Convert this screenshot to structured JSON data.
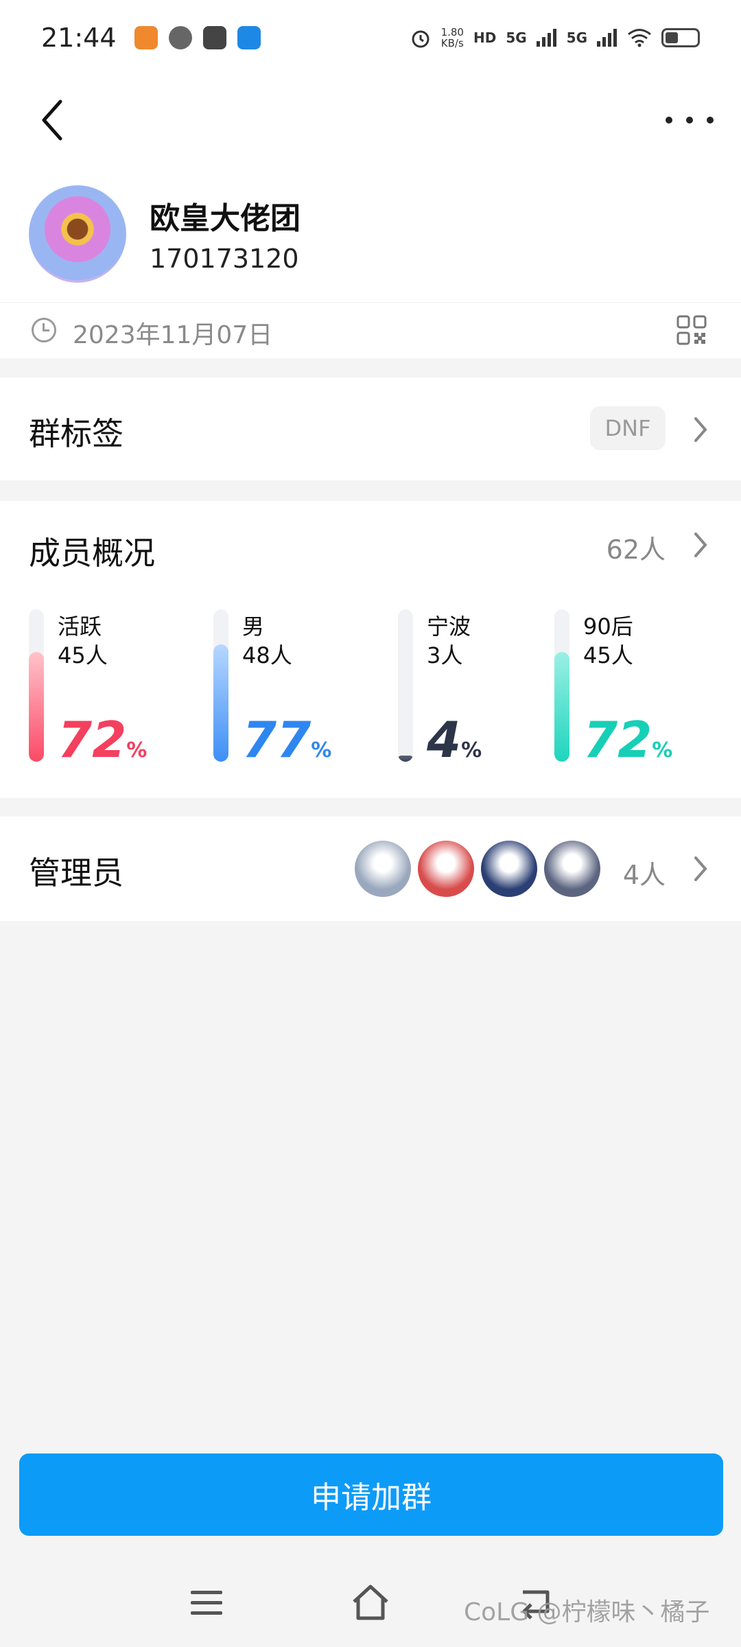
{
  "status_bar": {
    "time": "21:44",
    "net_speed_value": "1.80",
    "net_speed_unit": "KB/s",
    "hd_label": "HD",
    "signal1": "5G",
    "signal2": "5G",
    "app_icons": [
      {
        "name": "app-icon-1",
        "color": "#f0892e"
      },
      {
        "name": "wechat-icon",
        "color": "#555555"
      },
      {
        "name": "mail-icon",
        "color": "#444444"
      },
      {
        "name": "app-icon-4",
        "color": "#1e88e5"
      }
    ]
  },
  "header": {
    "back_icon": "chevron-left-icon",
    "more_icon": "more-dots-icon"
  },
  "group": {
    "name": "欧皇大佬团",
    "id": "170173120",
    "created_date": "2023年11月07日"
  },
  "tags": {
    "title": "群标签",
    "chip": "DNF"
  },
  "members": {
    "title": "成员概况",
    "count": "62人",
    "stats": [
      {
        "label": "活跃",
        "count": "45人",
        "percent": "72",
        "unit": "%",
        "fill": 0.72,
        "color_top": "#ffc3cb",
        "color_bottom": "#fb4a66",
        "text_color": "#f43f5e"
      },
      {
        "label": "男",
        "count": "48人",
        "percent": "77",
        "unit": "%",
        "fill": 0.77,
        "color_top": "#b7d7ff",
        "color_bottom": "#3d8ff5",
        "text_color": "#2f86f0"
      },
      {
        "label": "宁波",
        "count": "3人",
        "percent": "4",
        "unit": "%",
        "fill": 0.04,
        "color_top": "#5b6478",
        "color_bottom": "#3a4256",
        "text_color": "#2d3548"
      },
      {
        "label": "90后",
        "count": "45人",
        "percent": "72",
        "unit": "%",
        "fill": 0.72,
        "color_top": "#9af0e4",
        "color_bottom": "#1ed5bd",
        "text_color": "#16cfb7"
      }
    ]
  },
  "admins": {
    "title": "管理员",
    "count": "4人",
    "avatars": [
      {
        "name": "admin-avatar-1",
        "color": "#9aa8bd"
      },
      {
        "name": "admin-avatar-2",
        "color": "#d84c4c"
      },
      {
        "name": "admin-avatar-3",
        "color": "#2a3f73"
      },
      {
        "name": "admin-avatar-4",
        "color": "#5c6580"
      }
    ]
  },
  "join": {
    "button_label": "申请加群"
  },
  "nav": {
    "watermark": "CoLG @柠檬味丶橘子"
  }
}
